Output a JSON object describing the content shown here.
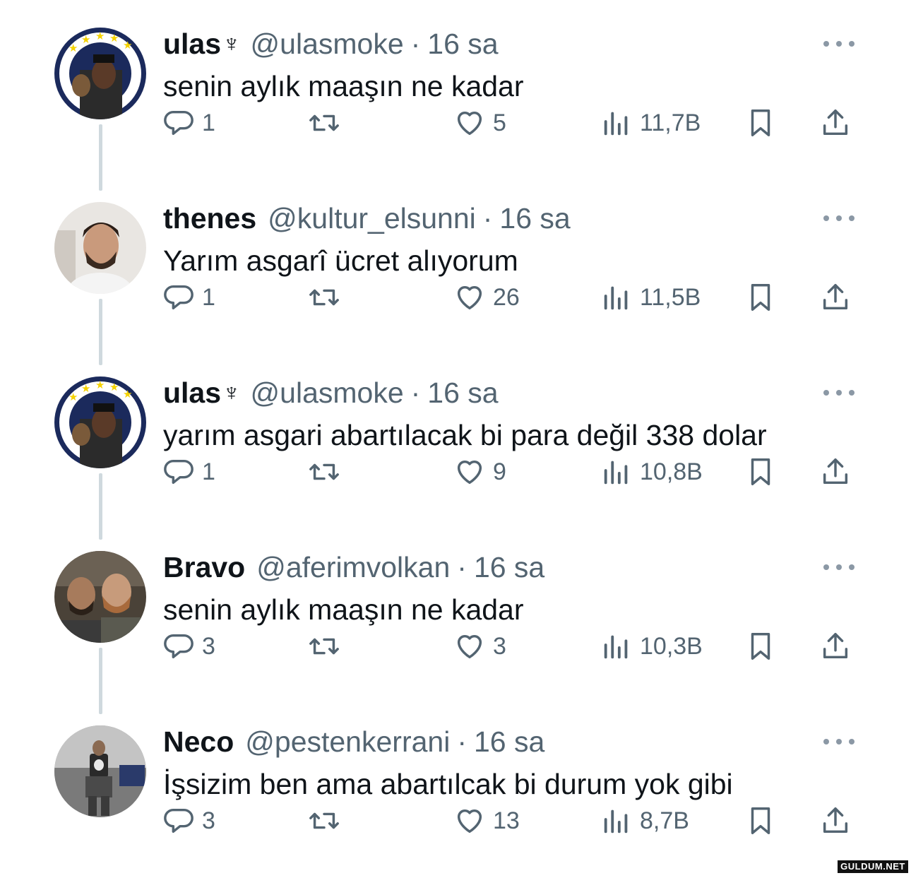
{
  "tweets": [
    {
      "name": "ulas",
      "name_icon": "♆",
      "handle": "@ulasmoke",
      "separator": "·",
      "time": "16 sa",
      "text": "senin aylık maaşın ne kadar",
      "replies": "1",
      "retweets": "",
      "likes": "5",
      "views": "11,7B",
      "avatar": "fenerbahce-crest-portrait"
    },
    {
      "name": "thenes",
      "name_icon": "",
      "handle": "@kultur_elsunni",
      "separator": "·",
      "time": "16 sa",
      "text": "Yarım asgarî ücret alıyorum",
      "replies": "1",
      "retweets": "",
      "likes": "26",
      "views": "11,5B",
      "avatar": "bearded-man-portrait"
    },
    {
      "name": "ulas",
      "name_icon": "♆",
      "handle": "@ulasmoke",
      "separator": "·",
      "time": "16 sa",
      "text": "yarım asgari abartılacak bi para değil 338 dolar",
      "replies": "1",
      "retweets": "",
      "likes": "9",
      "views": "10,8B",
      "avatar": "fenerbahce-crest-portrait"
    },
    {
      "name": "Bravo",
      "name_icon": "",
      "handle": "@aferimvolkan",
      "separator": "·",
      "time": "16 sa",
      "text": "senin aylık maaşın ne kadar",
      "replies": "3",
      "retweets": "",
      "likes": "3",
      "views": "10,3B",
      "avatar": "two-men-portrait"
    },
    {
      "name": "Neco",
      "name_icon": "",
      "handle": "@pestenkerrani",
      "separator": "·",
      "time": "16 sa",
      "text": "İşsizim ben ama abartılcak bi durum yok gibi",
      "replies": "3",
      "retweets": "",
      "likes": "13",
      "views": "8,7B",
      "avatar": "punisher-figure-portrait"
    }
  ],
  "icons": {
    "reply": "reply-icon",
    "retweet": "retweet-icon",
    "like": "heart-icon",
    "views": "views-chart-icon",
    "bookmark": "bookmark-icon",
    "share": "share-icon",
    "more": "more-options-icon"
  },
  "colors": {
    "text": "#0f1419",
    "secondary": "#536471",
    "thread_line": "#cfd9de"
  },
  "watermark": "GULDUM.NET"
}
